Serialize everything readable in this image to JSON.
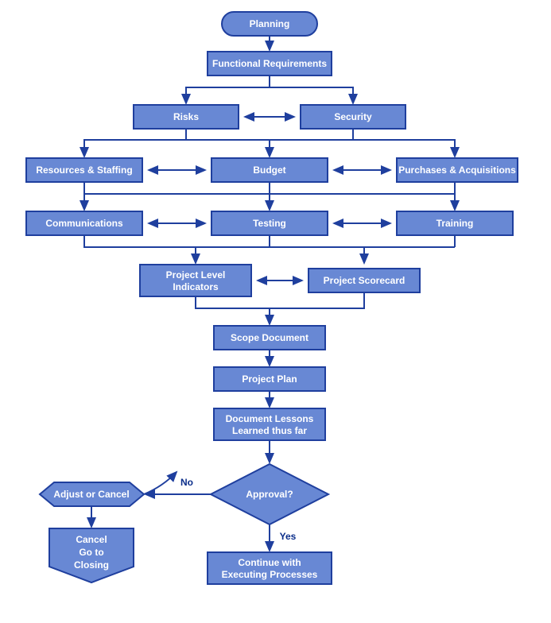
{
  "colors": {
    "nodeFill": "#6888d4",
    "nodeStroke": "#1f3f9e",
    "textWhite": "#ffffff",
    "textDark": "#0a2d8a"
  },
  "nodes": {
    "planning": "Planning",
    "functionalRequirements": "Functional Requirements",
    "risks": "Risks",
    "security": "Security",
    "resourcesStaffing": "Resources & Staffing",
    "budget": "Budget",
    "purchasesAcquisitions": "Purchases & Acquisitions",
    "communications": "Communications",
    "testing": "Testing",
    "training": "Training",
    "projectLevelIndicators_l1": "Project Level",
    "projectLevelIndicators_l2": "Indicators",
    "projectScorecard": "Project Scorecard",
    "scopeDocument": "Scope Document",
    "projectPlan": "Project Plan",
    "documentLessons_l1": "Document Lessons",
    "documentLessons_l2": "Learned thus far",
    "approval": "Approval?",
    "adjustOrCancel": "Adjust or Cancel",
    "cancelGoTo_l1": "Cancel",
    "cancelGoTo_l2": "Go to",
    "cancelGoTo_l3": "Closing",
    "continueExec_l1": "Continue with",
    "continueExec_l2": "Executing Processes"
  },
  "decisionLabels": {
    "no": "No",
    "yes": "Yes"
  }
}
